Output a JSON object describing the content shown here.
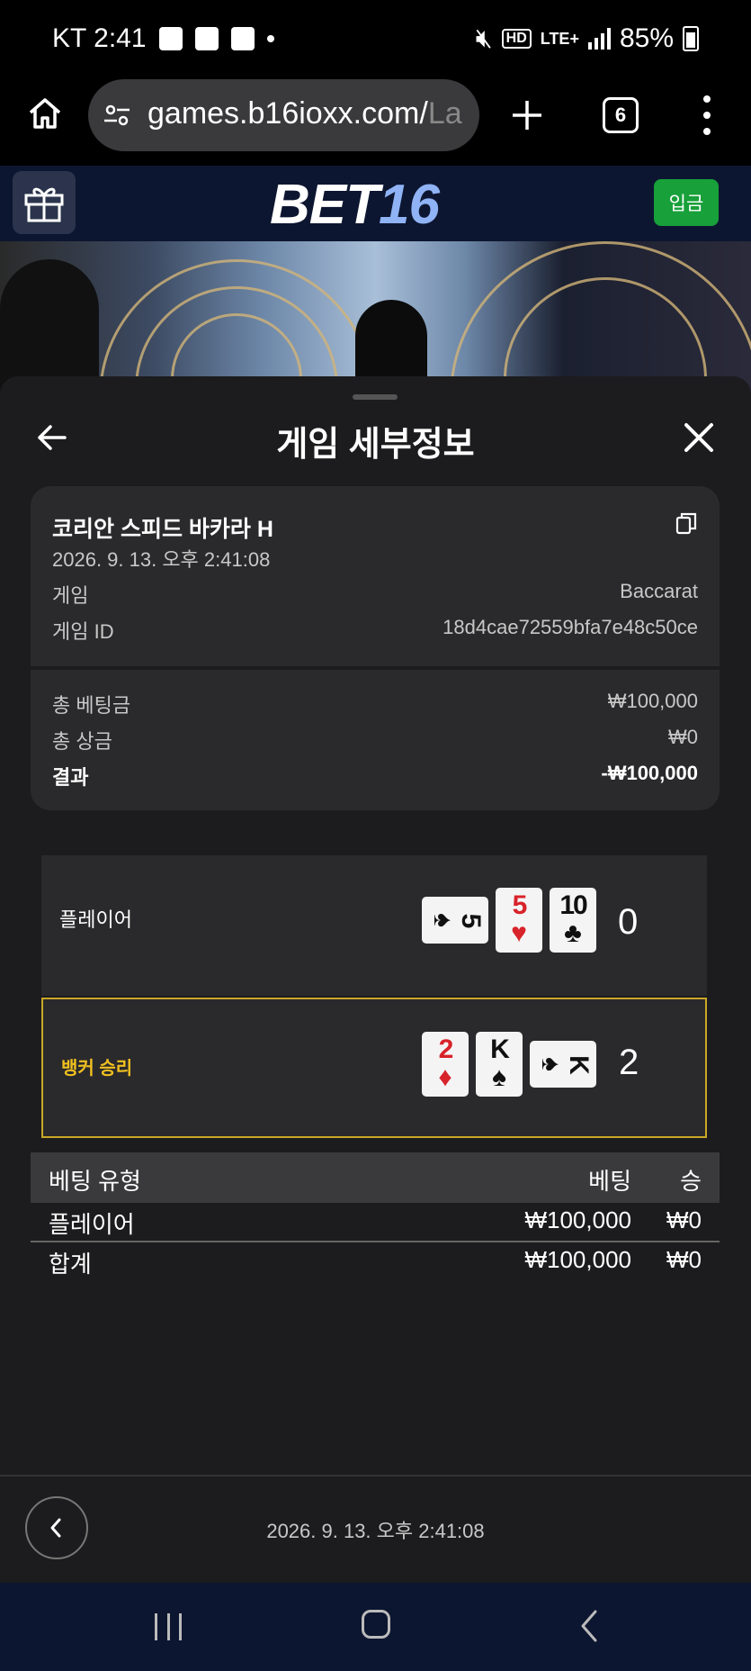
{
  "status_bar": {
    "carrier_time": "KT 2:41",
    "hd": "HD",
    "network": "LTE+",
    "battery": "85%"
  },
  "browser": {
    "url": "games.b16ioxx.com/",
    "url_faded": "La",
    "tab_count": "6"
  },
  "site": {
    "logo_part1": "BET",
    "logo_part2": "16",
    "deposit_label": "입금"
  },
  "sheet": {
    "title": "게임 세부정보",
    "game_name": "코리안 스피드 바카라 H",
    "datetime": "2026. 9. 13. 오후 2:41:08",
    "rows": [
      {
        "label": "게임",
        "value": "Baccarat"
      },
      {
        "label": "게임 ID",
        "value": "18d4cae72559bfa7e48c50ce"
      }
    ],
    "totals": [
      {
        "label": "총 베팅금",
        "value": "₩100,000"
      },
      {
        "label": "총 상금",
        "value": "₩0"
      },
      {
        "label": "결과",
        "value": "-₩100,000"
      }
    ],
    "player": {
      "label": "플레이어",
      "score": "0",
      "cards": [
        {
          "rank": "5",
          "suit": "♠",
          "orientation": "side",
          "color": "black"
        },
        {
          "rank": "5",
          "suit": "♥",
          "orientation": "up",
          "color": "red"
        },
        {
          "rank": "10",
          "suit": "♣",
          "orientation": "up",
          "color": "black"
        }
      ]
    },
    "banker": {
      "label": "뱅커 승리",
      "score": "2",
      "cards": [
        {
          "rank": "2",
          "suit": "♦",
          "orientation": "up",
          "color": "red"
        },
        {
          "rank": "K",
          "suit": "♠",
          "orientation": "up",
          "color": "black"
        },
        {
          "rank": "K",
          "suit": "♠",
          "orientation": "side",
          "color": "black"
        }
      ]
    },
    "bets": {
      "headers": {
        "type": "베팅 유형",
        "bet": "베팅",
        "win": "승"
      },
      "rows": [
        {
          "type": "플레이어",
          "bet": "₩100,000",
          "win": "₩0"
        }
      ],
      "total": {
        "type": "합계",
        "bet": "₩100,000",
        "win": "₩0"
      }
    },
    "footer_datetime": "2026. 9. 13. 오후 2:41:08"
  },
  "colors": {
    "banker_highlight": "#c9a828",
    "deposit_green": "#18a03a",
    "header_navy": "#0d1630"
  }
}
